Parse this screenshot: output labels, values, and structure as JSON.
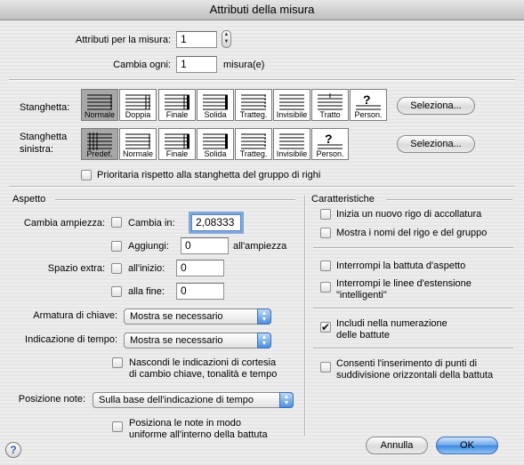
{
  "window": {
    "title": "Attributi della misura"
  },
  "top": {
    "attr_label": "Attributi per la misura:",
    "attr_value": "1",
    "change_label": "Cambia ogni:",
    "change_value": "1",
    "change_unit": "misura(e)"
  },
  "barline": {
    "label": "Stanghetta:",
    "options": [
      "Normale",
      "Doppia",
      "Finale",
      "Solida",
      "Tratteg.",
      "Invisibile",
      "Tratto",
      "Person."
    ],
    "selected": "Normale",
    "select_button": "Seleziona..."
  },
  "left_barline": {
    "label_line1": "Stanghetta",
    "label_line2": "sinistra:",
    "options": [
      "Predef.",
      "Normale",
      "Finale",
      "Solida",
      "Tratteg.",
      "Invisibile",
      "Person."
    ],
    "selected": "Predef.",
    "select_button": "Seleziona...",
    "priority_label": "Prioritaria rispetto alla stanghetta del gruppo di righi"
  },
  "aspect": {
    "section_title": "Aspetto",
    "width_label": "Cambia ampiezza:",
    "width_in_label": "Cambia in:",
    "width_in_value": "2,08333",
    "add_label": "Aggiungi:",
    "add_value": "0",
    "add_suffix": "all'ampiezza",
    "extra_label": "Spazio extra:",
    "start_label": "all'inizio:",
    "start_value": "0",
    "end_label": "alla fine:",
    "end_value": "0",
    "key_label": "Armatura di chiave:",
    "key_value": "Mostra se necessario",
    "time_label": "Indicazione di tempo:",
    "time_value": "Mostra se necessario",
    "hide_courtesy_line1": "Nascondi le indicazioni di cortesia",
    "hide_courtesy_line2": "di cambio chiave, tonalità e tempo",
    "note_pos_label": "Posizione note:",
    "note_pos_value": "Sulla base dell'indicazione di tempo",
    "uniform_line1": "Posiziona le note in modo",
    "uniform_line2": "uniforme all'interno della battuta"
  },
  "features": {
    "section_title": "Caratteristiche",
    "new_system": "Inizia un nuovo rigo di accollatura",
    "show_names": "Mostra i nomi del rigo e del gruppo",
    "break_rest": "Interrompi la battuta d'aspetto",
    "break_ext_line1": "Interrompi le linee d'estensione",
    "break_ext_line2": "\"intelligenti\"",
    "include_num_line1": "Includi nella numerazione",
    "include_num_line2": "delle battute",
    "allow_split_line1": "Consenti l'inserimento di punti di",
    "allow_split_line2": "suddivisione orizzontali della battuta"
  },
  "footer": {
    "help": "?",
    "cancel": "Annulla",
    "ok": "OK"
  }
}
